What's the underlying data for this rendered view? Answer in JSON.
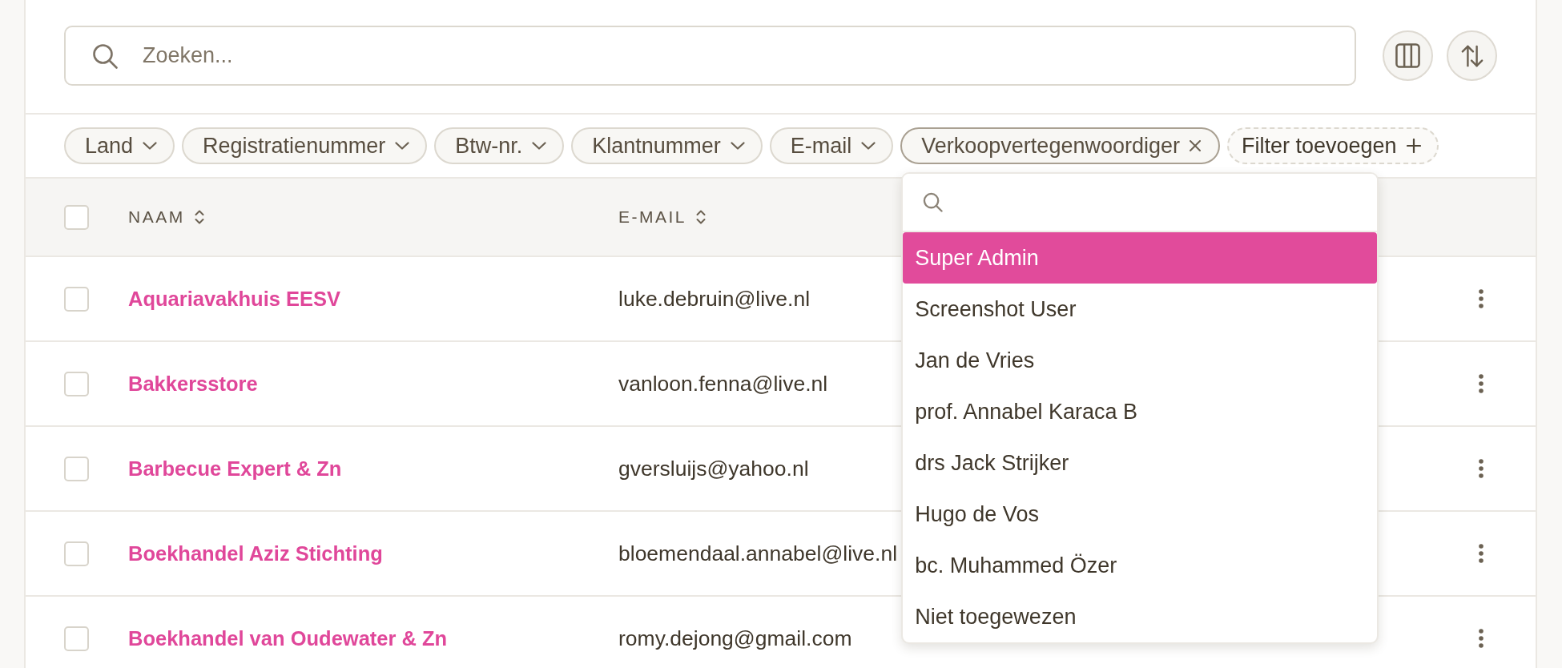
{
  "search": {
    "placeholder": "Zoeken..."
  },
  "filters": [
    {
      "label": "Land",
      "kind": "select",
      "open": false
    },
    {
      "label": "Registratienummer",
      "kind": "select",
      "open": false
    },
    {
      "label": "Btw-nr.",
      "kind": "select",
      "open": false
    },
    {
      "label": "Klantnummer",
      "kind": "select",
      "open": false
    },
    {
      "label": "E-mail",
      "kind": "select",
      "open": false
    },
    {
      "label": "Verkoopvertegenwoordiger",
      "kind": "applied",
      "open": true
    },
    {
      "label": "Filter toevoegen",
      "kind": "add",
      "open": false
    }
  ],
  "filter_menu": {
    "items": [
      {
        "label": "Super Admin",
        "selected": true
      },
      {
        "label": "Screenshot User",
        "selected": false
      },
      {
        "label": "Jan de Vries",
        "selected": false
      },
      {
        "label": "prof. Annabel Karaca B",
        "selected": false
      },
      {
        "label": "drs Jack Strijker",
        "selected": false
      },
      {
        "label": "Hugo de Vos",
        "selected": false
      },
      {
        "label": "bc. Muhammed Özer",
        "selected": false
      },
      {
        "label": "Niet toegewezen",
        "selected": false
      }
    ]
  },
  "table": {
    "all_checked": false,
    "columns": [
      {
        "label": "NAAM",
        "sortable": true
      },
      {
        "label": "E-MAIL",
        "sortable": true
      }
    ],
    "rows": [
      {
        "name": "Aquariavakhuis EESV",
        "email": "luke.debruin@live.nl",
        "checked": false
      },
      {
        "name": "Bakkersstore",
        "email": "vanloon.fenna@live.nl",
        "checked": false
      },
      {
        "name": "Barbecue Expert & Zn",
        "email": "gversluijs@yahoo.nl",
        "checked": false
      },
      {
        "name": "Boekhandel Aziz Stichting",
        "email": "bloemendaal.annabel@live.nl",
        "checked": false
      },
      {
        "name": "Boekhandel van Oudewater & Zn",
        "email": "romy.dejong@gmail.com",
        "checked": false
      }
    ]
  }
}
